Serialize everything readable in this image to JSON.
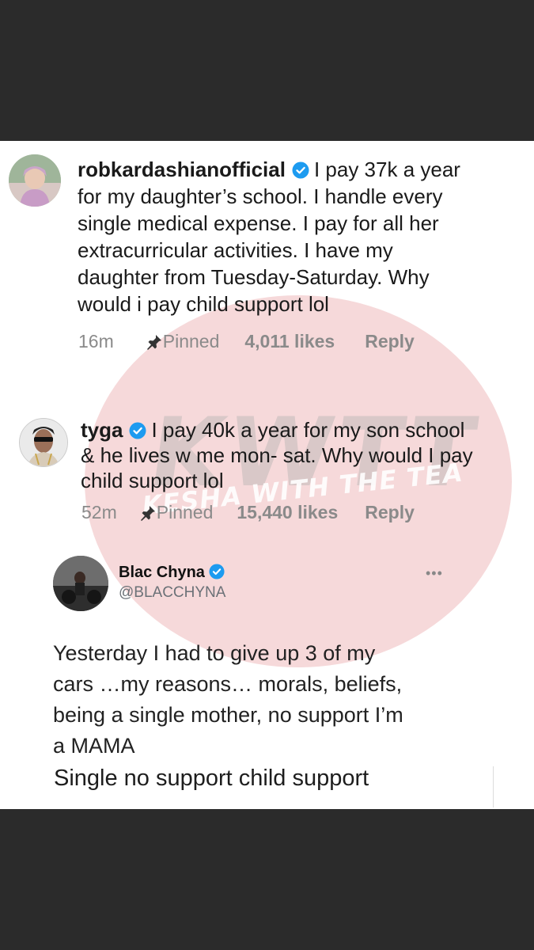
{
  "watermark": {
    "letters": "KWTT",
    "text": "KESHA WITH THE TEA"
  },
  "comment1": {
    "username": "robkardashianofficial",
    "text": "I pay 37k a year for my daughter’s school. I handle every single medical expense. I pay for all her extracurricular activities. I have my daughter from Tuesday-Saturday. Why would i pay child support lol",
    "line1": "I pay 37k a year",
    "line2": "for my daughter’s school. I handle every",
    "line3": "single medical expense. I pay for all her",
    "line4": "extracurricular activities. I have my",
    "line5": "daughter from Tuesday-Saturday. Why",
    "line6": "would i pay child support lol",
    "time": "16m",
    "pinned": "Pinned",
    "likes": "4,011 likes",
    "reply": "Reply"
  },
  "comment2": {
    "username": "tyga",
    "line1": "I pay 40k a year for my son school",
    "line2": "& he lives  w me mon- sat. Why would I pay",
    "line3": "child support lol",
    "time": "52m",
    "pinned": "Pinned",
    "likes": "15,440 likes",
    "reply": "Reply"
  },
  "tweet": {
    "name": "Blac Chyna",
    "handle": "@BLACCHYNA",
    "more": "•••",
    "line1": "Yesterday I had to give up 3 of my",
    "line2": "cars …my reasons… morals, beliefs,",
    "line3": "being a single mother, no support I’m",
    "line4": "a MAMA",
    "extra": "Single no support child support"
  },
  "colors": {
    "verified": "#1d9bf0",
    "background": "#2b2b2b",
    "panel": "#ffffff",
    "muted": "#8a8a8a"
  }
}
